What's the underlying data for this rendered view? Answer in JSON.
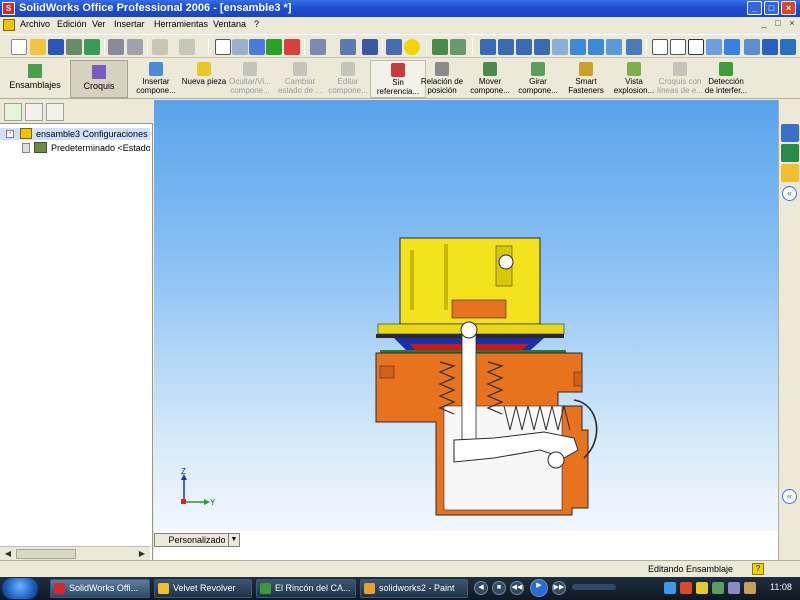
{
  "window": {
    "title": "SolidWorks Office Professional 2006 - [ensamble3 *]",
    "controls": {
      "minimize": "_",
      "maximize": "□",
      "close": "×"
    }
  },
  "menu": {
    "items": [
      "Archivo",
      "Edición",
      "Ver",
      "Insertar",
      "Herramientas",
      "Ventana",
      "?"
    ],
    "mdi_controls": {
      "minimize": "_",
      "restore": "□",
      "close": "×"
    }
  },
  "command_manager": {
    "tabs": [
      {
        "label": "Ensamblajes"
      },
      {
        "label": "Croquis"
      }
    ],
    "commands": [
      {
        "line1": "Insertar",
        "line2": "compone...",
        "enabled": true,
        "icon": "insert-component-icon"
      },
      {
        "line1": "Nueva pieza",
        "line2": "",
        "enabled": true,
        "icon": "new-part-icon"
      },
      {
        "line1": "Ocultar/Vi...",
        "line2": "compone...",
        "enabled": false,
        "icon": "hide-show-icon"
      },
      {
        "line1": "Cambiar",
        "line2": "estado de ...",
        "enabled": false,
        "icon": "change-state-icon"
      },
      {
        "line1": "Editar",
        "line2": "compone...",
        "enabled": false,
        "icon": "edit-component-icon"
      },
      {
        "line1": "Sin",
        "line2": "referencia...",
        "enabled": true,
        "icon": "no-external-ref-icon"
      },
      {
        "line1": "Relación de",
        "line2": "posición",
        "enabled": true,
        "icon": "mate-icon"
      },
      {
        "line1": "Mover",
        "line2": "compone...",
        "enabled": true,
        "icon": "move-component-icon"
      },
      {
        "line1": "Girar",
        "line2": "compone...",
        "enabled": true,
        "icon": "rotate-component-icon"
      },
      {
        "line1": "Smart",
        "line2": "Fasteners",
        "enabled": true,
        "icon": "smart-fasteners-icon"
      },
      {
        "line1": "Vista",
        "line2": "explosion...",
        "enabled": true,
        "icon": "exploded-view-icon"
      },
      {
        "line1": "Croquis con",
        "line2": "líneas de e...",
        "enabled": false,
        "icon": "explode-line-sketch-icon"
      },
      {
        "line1": "Detección",
        "line2": "de interfer...",
        "enabled": true,
        "icon": "interference-detection-icon"
      }
    ]
  },
  "feature_tree": {
    "root": "ensamble3 Configuraciones",
    "child": "Predeterminado <Estado d"
  },
  "viewport": {
    "triad": {
      "z": "Z",
      "y": "Y"
    }
  },
  "configuration_tab": {
    "label": "Personalizado"
  },
  "status": {
    "text": "Editando Ensamblaje",
    "help": "?"
  },
  "taskbar": {
    "buttons": [
      {
        "label": "SolidWorks Offi...",
        "active": true,
        "color": "#d8262c"
      },
      {
        "label": "Velvet Revolver",
        "active": false,
        "color": "#f0c030"
      },
      {
        "label": "El Rincón del CA...",
        "active": false,
        "color": "#3a9a3a"
      },
      {
        "label": "solidworks2 - Paint",
        "active": false,
        "color": "#e8a030"
      }
    ],
    "clock": "11:08"
  },
  "colors": {
    "titlebar": "#1e4fd1",
    "viewport_top": "#58a3ec",
    "viewport_bottom": "#f2f8fd",
    "housing_yellow": "#f4e21c",
    "body_orange": "#e8731e"
  }
}
